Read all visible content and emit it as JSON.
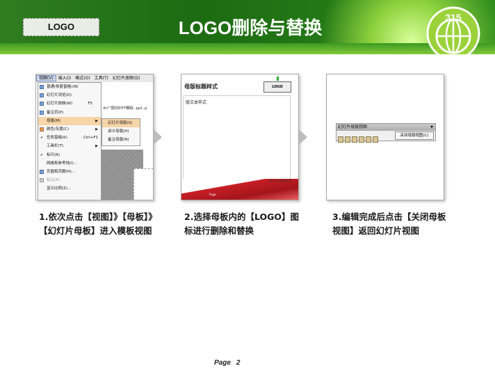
{
  "header": {
    "logo_placeholder": "LOGO",
    "title": "LOGO删除与替换",
    "emblem_text": "315"
  },
  "step1": {
    "menubar": [
      "视图(V)",
      "插入(I)",
      "格式(O)",
      "工具(T)",
      "幻灯片放映(D)"
    ],
    "menu_items": [
      {
        "label": "普通(恢复窗格)(N)",
        "key": ""
      },
      {
        "label": "幻灯片浏览(D)",
        "key": ""
      },
      {
        "label": "幻灯片放映(W)",
        "key": "F5"
      },
      {
        "label": "备注页(P)",
        "key": ""
      },
      {
        "label": "母版(M)",
        "key": "",
        "highlight": true
      },
      {
        "label": "颜色/灰度(C)",
        "key": ""
      },
      {
        "label": "任务窗格(K)",
        "key": "Ctrl+F1"
      },
      {
        "label": "工具栏(T)",
        "key": ""
      },
      {
        "label": "标尺(R)",
        "key": ""
      },
      {
        "label": "网格和参考线(I)...",
        "key": ""
      },
      {
        "label": "页眉和页脚(H)...",
        "key": ""
      },
      {
        "label": "标记(A)",
        "key": ""
      },
      {
        "label": "显示比例(Z)...",
        "key": ""
      }
    ],
    "submenu_items": [
      "幻灯片母版(S)",
      "讲义母版(H)",
      "备注母版(N)"
    ],
    "doc_title": "dn\"\"股创PPT模板..ppt..p",
    "caption": "1.依次点击【视图】》【母板】》【幻灯片母板】进入模板视图"
  },
  "step2": {
    "master_title": "母版标题样式",
    "logo_label": "LOGO",
    "body_text": "版文本样式",
    "footer_text": "某公司名称或标语",
    "page_label": "Page",
    "caption": "2.选择母板内的【LOGO】图标进行删除和替换"
  },
  "step3": {
    "toolbar_title": "幻灯片母版视图",
    "close_button": "关闭母版视图(C)",
    "caption": "3.编辑完成后点击【关闭母板视图】返回幻灯片视图"
  },
  "footer": {
    "page_label": "Page",
    "page_number": "2"
  }
}
